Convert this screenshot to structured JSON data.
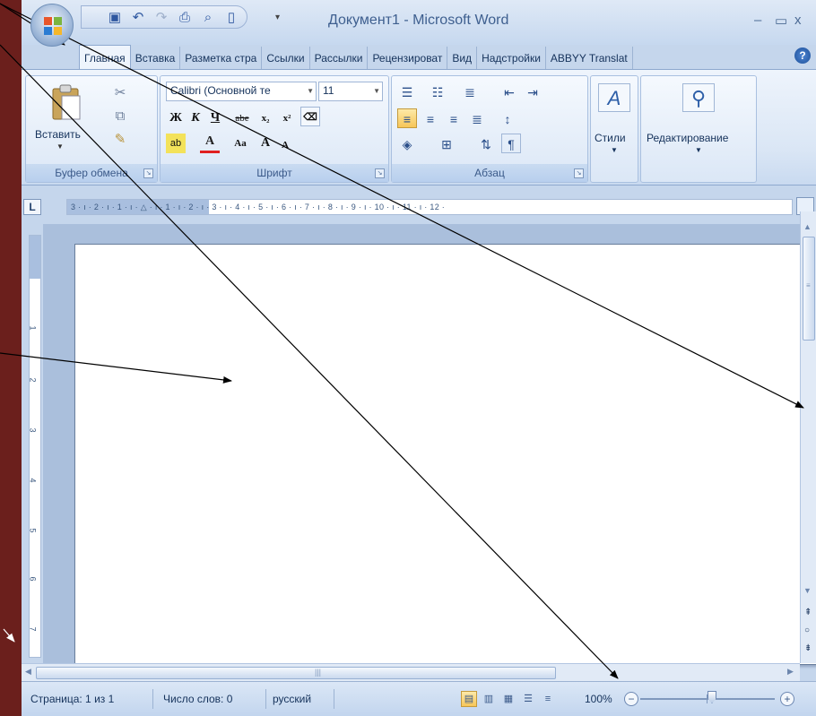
{
  "window": {
    "title": "Документ1 - Microsoft Word",
    "minimize": "–",
    "maximize": "▭",
    "close": "x"
  },
  "quick_access": {
    "icons": [
      "save-icon",
      "undo-icon",
      "redo-icon",
      "print-icon",
      "print-preview-icon",
      "new-document-icon"
    ],
    "dropdown": "▾"
  },
  "tabs": [
    {
      "label": "Главная",
      "active": true
    },
    {
      "label": "Вставка"
    },
    {
      "label": "Разметка стра"
    },
    {
      "label": "Ссылки"
    },
    {
      "label": "Рассылки"
    },
    {
      "label": "Рецензироват"
    },
    {
      "label": "Вид"
    },
    {
      "label": "Надстройки"
    },
    {
      "label": "ABBYY Translat"
    }
  ],
  "ribbon": {
    "clipboard": {
      "label": "Буфер обмена",
      "paste": "Вставить"
    },
    "font": {
      "label": "Шрифт",
      "font_name": "Calibri (Основной те",
      "font_size": "11",
      "bold": "Ж",
      "italic": "К",
      "underline": "Ч",
      "strikethrough": "abe",
      "subscript": "x₂",
      "superscript": "x²",
      "change_case": "Aa",
      "grow": "A",
      "shrink": "A"
    },
    "paragraph": {
      "label": "Абзац",
      "show_marks": "¶"
    },
    "styles": {
      "label": "Стили"
    },
    "editing": {
      "label": "Редактирование"
    }
  },
  "ruler": {
    "tab_selector": "L",
    "marks": "3 · ı · 2 · ı · 1 · ı · △ · ı · 1 · ı · 2 · ı · 3 · ı · 4 · ı · 5 · ı · 6 · ı · 7 · ı · 8 · ı · 9 · ı · 10 · ı · 11 · ı · 12 ·",
    "vertical_numbers": [
      "1",
      "2",
      "3",
      "4",
      "5",
      "6",
      "7"
    ]
  },
  "statusbar": {
    "page": "Страница: 1 из 1",
    "words": "Число слов: 0",
    "language": "русский",
    "zoom": "100%",
    "zoom_level": 1.0
  },
  "colors": {
    "background": "#6b1f1c",
    "ribbon": "#dae6f5",
    "active_button": "#f7c659",
    "arrow": "#000000"
  }
}
